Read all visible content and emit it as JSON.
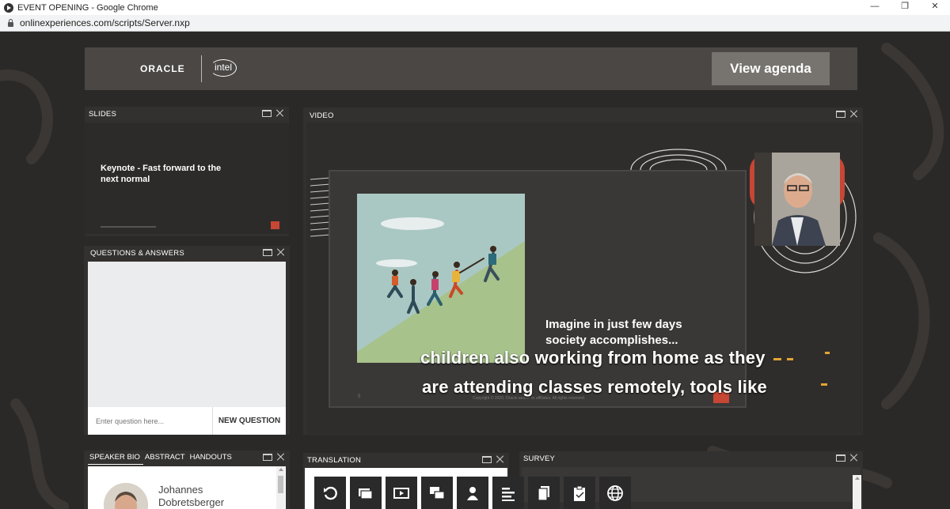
{
  "window": {
    "title": "EVENT OPENING - Google Chrome",
    "url": "onlinexperiences.com/scripts/Server.nxp",
    "controls": [
      "—",
      "❐",
      "✕"
    ]
  },
  "banner": {
    "oracle_logo": "ORACLE",
    "intel_logo": "intel",
    "agenda_button": "View agenda"
  },
  "slides": {
    "title": "SLIDES",
    "slide_title": "Keynote - Fast forward to the next normal"
  },
  "qa": {
    "title": "QUESTIONS & ANSWERS",
    "input_placeholder": "Enter question here...",
    "new_question_button": "NEW QUESTION"
  },
  "video": {
    "title": "VIDEO",
    "slide_text": "Imagine in just few days society accomplishes...",
    "subtitle_line1": "children also working from home as they",
    "subtitle_line2": "are attending classes remotely, tools like",
    "copyright": "Copyright © 2020, Oracle and/or its affiliates. All rights reserved.",
    "slide_number": "5"
  },
  "speaker_bio": {
    "tabs": [
      "SPEAKER BIO",
      "ABSTRACT",
      "HANDOUTS"
    ],
    "active_tab": 0,
    "name_line1": "Johannes",
    "name_line2": "Dobretsberger"
  },
  "translation": {
    "title": "TRANSLATION",
    "tools": [
      "refresh-icon",
      "slides-icon",
      "video-icon",
      "chat-icon",
      "speaker-icon",
      "agenda-icon",
      "handouts-icon",
      "survey-icon",
      "globe-icon"
    ]
  },
  "survey": {
    "title": "SURVEY"
  },
  "colors": {
    "background": "#2b2927",
    "panel": "#33312f",
    "banner": "#4a4745",
    "agenda_button": "#77736f",
    "oracle_red": "#c74634"
  }
}
